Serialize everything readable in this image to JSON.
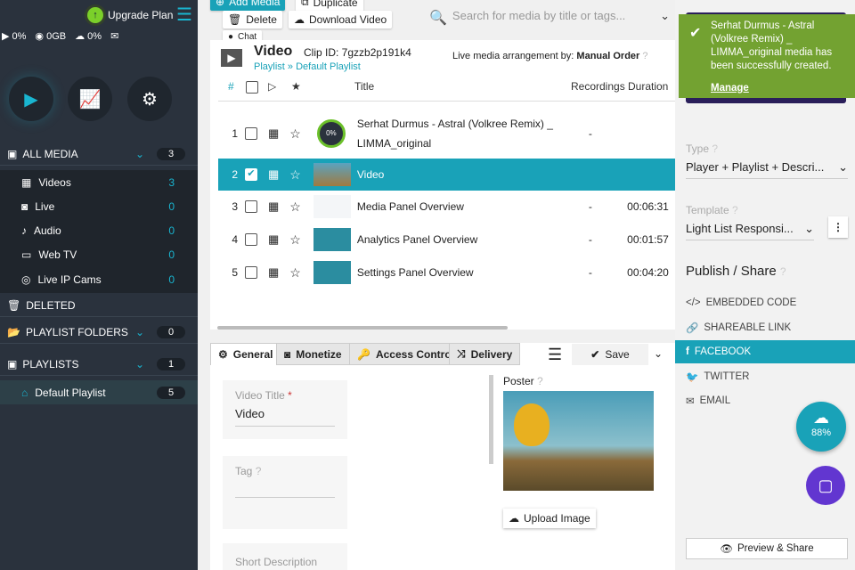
{
  "sidebar": {
    "upgrade": "Upgrade Plan",
    "stats": {
      "plays": "0%",
      "storage": "0GB",
      "bandwidth": "0%"
    },
    "all_media": {
      "label": "ALL MEDIA",
      "count": "3"
    },
    "items": [
      {
        "label": "Videos",
        "count": "3"
      },
      {
        "label": "Live",
        "count": "0"
      },
      {
        "label": "Audio",
        "count": "0"
      },
      {
        "label": "Web TV",
        "count": "0"
      },
      {
        "label": "Live IP Cams",
        "count": "0"
      }
    ],
    "deleted": "DELETED",
    "folders": {
      "label": "PLAYLIST FOLDERS",
      "count": "0"
    },
    "playlists": {
      "label": "PLAYLISTS",
      "count": "1"
    },
    "default_playlist": {
      "label": "Default Playlist",
      "count": "5"
    }
  },
  "toolbar": {
    "add": "Add Media",
    "duplicate": "Duplicate",
    "delete": "Delete",
    "download": "Download Video",
    "chat": "Chat",
    "search_placeholder": "Search for media by title or tags..."
  },
  "header": {
    "title": "Video",
    "clip_id": "Clip ID: 7gzzb2p191k4",
    "crumb1": "Playlist",
    "crumb2": "Default Playlist",
    "arr_label": "Live media arrangement by:",
    "arr_value": "Manual Order"
  },
  "columns": {
    "num": "#",
    "title": "Title",
    "recordings": "Recordings",
    "duration": "Duration"
  },
  "rows": [
    {
      "num": "1",
      "title": "Serhat Durmus - Astral (Volkree Remix) _ LIMMA_original",
      "rec": "-",
      "dur": "",
      "progress": "0%"
    },
    {
      "num": "2",
      "title": "Video",
      "rec": "",
      "dur": ""
    },
    {
      "num": "3",
      "title": "Media Panel Overview",
      "rec": "-",
      "dur": "00:06:31"
    },
    {
      "num": "4",
      "title": "Analytics Panel Overview",
      "rec": "-",
      "dur": "00:01:57"
    },
    {
      "num": "5",
      "title": "Settings Panel Overview",
      "rec": "-",
      "dur": "00:04:20"
    }
  ],
  "tabs": {
    "general": "General",
    "monetize": "Monetize",
    "access": "Access Control",
    "delivery": "Delivery",
    "save": "Save"
  },
  "form": {
    "title_label": "Video Title",
    "title_value": "Video",
    "tag_label": "Tag",
    "short_desc": "Short Description",
    "poster": "Poster",
    "upload": "Upload Image"
  },
  "right": {
    "type_label": "Type",
    "type_value": "Player + Playlist + Descri...",
    "template_label": "Template",
    "template_value": "Light List Responsi...",
    "publish": "Publish / Share",
    "share": [
      "EMBEDDED CODE",
      "SHAREABLE LINK",
      "FACEBOOK",
      "TWITTER",
      "EMAIL"
    ],
    "upload_pct": "88%",
    "preview": "Preview & Share"
  },
  "toast": {
    "message": "Serhat Durmus - Astral (Volkree Remix) _ LIMMA_original media has been successfully created.",
    "link": "Manage"
  }
}
